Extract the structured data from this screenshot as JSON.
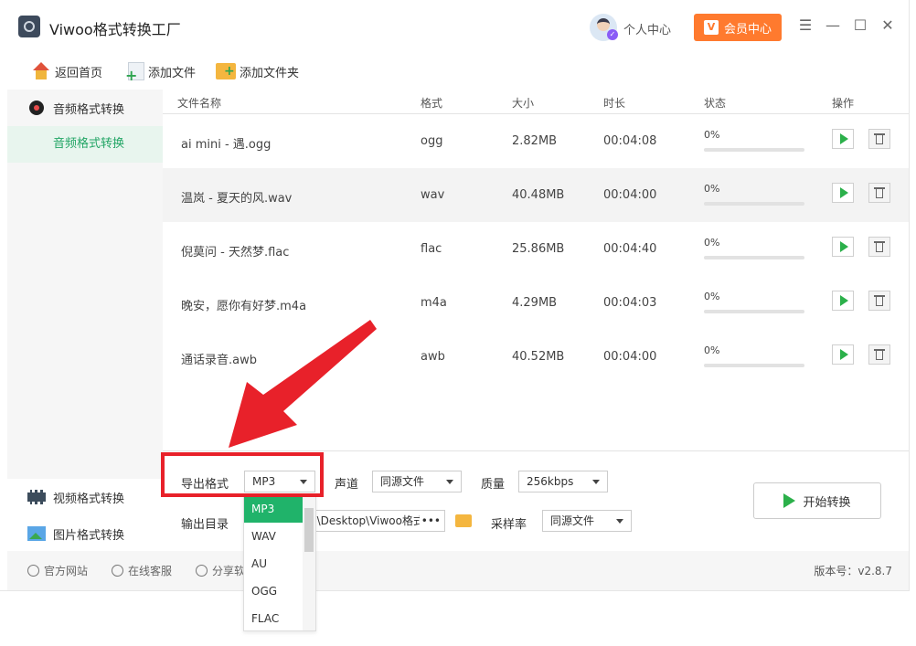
{
  "app": {
    "title": "Viwoo格式转换工厂"
  },
  "header": {
    "user_center": "个人中心",
    "vip_button": "会员中心",
    "vip_icon_letter": "V"
  },
  "toolbar": {
    "home": "返回首页",
    "add_file": "添加文件",
    "add_folder": "添加文件夹"
  },
  "sidebar": {
    "section_title": "音频格式转换",
    "active_item": "音频格式转换",
    "video": "视频格式转换",
    "image": "图片格式转换"
  },
  "table": {
    "headers": [
      "文件名称",
      "格式",
      "大小",
      "时长",
      "状态",
      "操作"
    ],
    "rows": [
      {
        "name": "ai mini - 遇.ogg",
        "format": "ogg",
        "size": "2.82MB",
        "duration": "00:04:08",
        "status": "0%",
        "progress": 0
      },
      {
        "name": "温岚 - 夏天的风.wav",
        "format": "wav",
        "size": "40.48MB",
        "duration": "00:04:00",
        "status": "0%",
        "progress": 0
      },
      {
        "name": "倪莫问 - 天然梦.flac",
        "format": "flac",
        "size": "25.86MB",
        "duration": "00:04:40",
        "status": "0%",
        "progress": 0
      },
      {
        "name": "晚安，愿你有好梦.m4a",
        "format": "m4a",
        "size": "4.29MB",
        "duration": "00:04:03",
        "status": "0%",
        "progress": 0
      },
      {
        "name": "通话录音.awb",
        "format": "awb",
        "size": "40.52MB",
        "duration": "00:04:00",
        "status": "0%",
        "progress": 0
      }
    ]
  },
  "settings": {
    "export_format_label": "导出格式",
    "export_format_value": "MP3",
    "channel_label": "声道",
    "channel_value": "同源文件",
    "quality_label": "质量",
    "quality_value": "256kbps",
    "output_dir_label": "输出目录",
    "output_dir_value": "1\\Desktop\\Viwoo格式",
    "output_dir_more": "•••",
    "sample_rate_label": "采样率",
    "sample_rate_value": "同源文件",
    "start_button": "开始转换"
  },
  "dropdown": {
    "options": [
      "MP3",
      "WAV",
      "AU",
      "OGG",
      "FLAC"
    ],
    "selected": "MP3"
  },
  "footer": {
    "website": "官方网站",
    "support": "在线客服",
    "share": "分享软",
    "version": "版本号：v2.8.7"
  },
  "colors": {
    "accent": "#22a565",
    "vip": "#ff7a2e",
    "highlight": "#e8212a"
  }
}
